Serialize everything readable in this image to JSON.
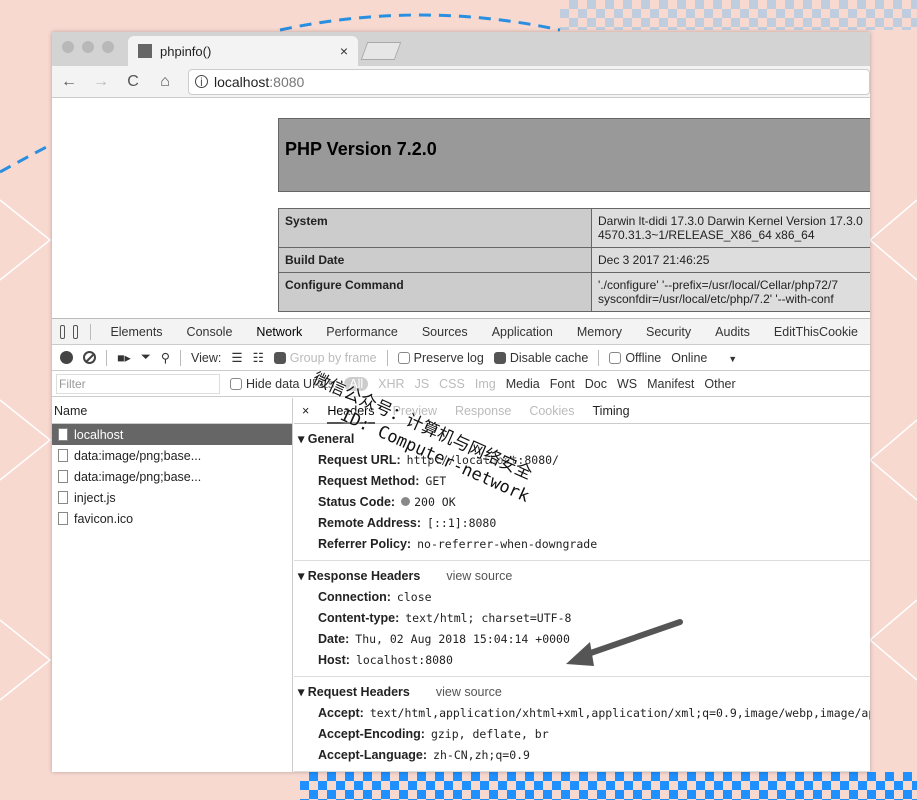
{
  "browser": {
    "tab_title": "phpinfo()",
    "tab_close": "×",
    "url_host": "localhost",
    "url_port": ":8080",
    "nav_back": "←",
    "nav_forward": "→",
    "nav_reload": "C",
    "nav_home": "⌂",
    "url_info": "i"
  },
  "phpinfo": {
    "title": "PHP Version 7.2.0",
    "rows": [
      {
        "key": "System",
        "value": "Darwin lt-didi 17.3.0 Darwin Kernel Version 17.3.0 4570.31.3~1/RELEASE_X86_64 x86_64"
      },
      {
        "key": "Build Date",
        "value": "Dec 3 2017 21:46:25"
      },
      {
        "key": "Configure Command",
        "value": "'./configure' '--prefix=/usr/local/Cellar/php72/7 sysconfdir=/usr/local/etc/php/7.2' '--with-conf"
      }
    ]
  },
  "devtools": {
    "tabs": [
      "Elements",
      "Console",
      "Network",
      "Performance",
      "Sources",
      "Application",
      "Memory",
      "Security",
      "Audits",
      "EditThisCookie"
    ],
    "active_tab": "Network",
    "controls": {
      "view_label": "View:",
      "group_by_frame": "Group by frame",
      "preserve_log": "Preserve log",
      "disable_cache": "Disable cache",
      "offline": "Offline",
      "throttle": "Online",
      "throttle_caret": "▼"
    },
    "filter": {
      "placeholder": "Filter",
      "hide_data_urls": "Hide data URLs",
      "types": [
        "All",
        "XHR",
        "JS",
        "CSS",
        "Img",
        "Media",
        "Font",
        "Doc",
        "WS",
        "Manifest",
        "Other"
      ]
    },
    "request_list": {
      "header": "Name",
      "items": [
        "localhost",
        "data:image/png;base...",
        "data:image/png;base...",
        "inject.js",
        "favicon.ico"
      ]
    },
    "detail_tabs": {
      "close": "×",
      "items": [
        "Headers",
        "Preview",
        "Response",
        "Cookies",
        "Timing"
      ]
    },
    "general": {
      "title": "General",
      "rows": [
        {
          "key": "Request URL:",
          "value": "http://localhost:8080/"
        },
        {
          "key": "Request Method:",
          "value": "GET"
        },
        {
          "key": "Status Code:",
          "value": "200 OK"
        },
        {
          "key": "Remote Address:",
          "value": "[::1]:8080"
        },
        {
          "key": "Referrer Policy:",
          "value": "no-referrer-when-downgrade"
        }
      ]
    },
    "response_headers": {
      "title": "Response Headers",
      "view_source": "view source",
      "rows": [
        {
          "key": "Connection:",
          "value": "close"
        },
        {
          "key": "Content-type:",
          "value": "text/html; charset=UTF-8"
        },
        {
          "key": "Date:",
          "value": "Thu, 02 Aug 2018 15:04:14 +0000"
        },
        {
          "key": "Host:",
          "value": "localhost:8080"
        }
      ]
    },
    "request_headers": {
      "title": "Request Headers",
      "view_source": "view source",
      "rows": [
        {
          "key": "Accept:",
          "value": "text/html,application/xhtml+xml,application/xml;q=0.9,image/webp,image/apng"
        },
        {
          "key": "Accept-Encoding:",
          "value": "gzip, deflate, br"
        },
        {
          "key": "Accept-Language:",
          "value": "zh-CN,zh;q=0.9"
        }
      ]
    }
  },
  "watermark": {
    "line1": "微信公众号：计算机与网络安全",
    "line2": "ID: Computer-network"
  },
  "colors": {
    "background": "#f7d9d0",
    "accent_blue": "#1e90ff"
  }
}
